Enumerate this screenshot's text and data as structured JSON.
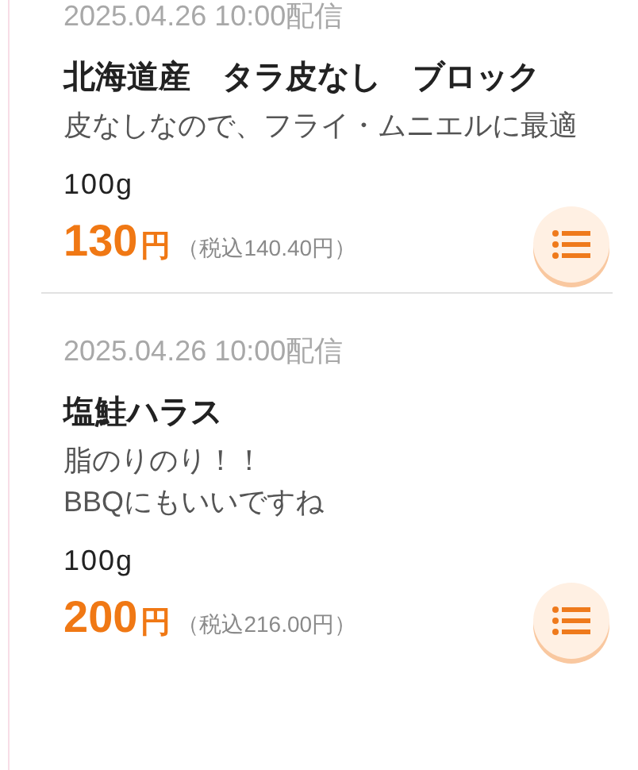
{
  "items": [
    {
      "date": "2025.04.26 10:00配信",
      "title": "北海道産　タラ皮なし　ブロック",
      "description": "皮なしなので、フライ・ムニエルに最適",
      "quantity": "100g",
      "price": "130",
      "currency": "円",
      "tax_included": "（税込140.40円）"
    },
    {
      "date": "2025.04.26 10:00配信",
      "title": "塩鮭ハラス",
      "description": "脂のりのり！！\nBBQにもいいですね",
      "quantity": "100g",
      "price": "200",
      "currency": "円",
      "tax_included": "（税込216.00円）"
    }
  ]
}
